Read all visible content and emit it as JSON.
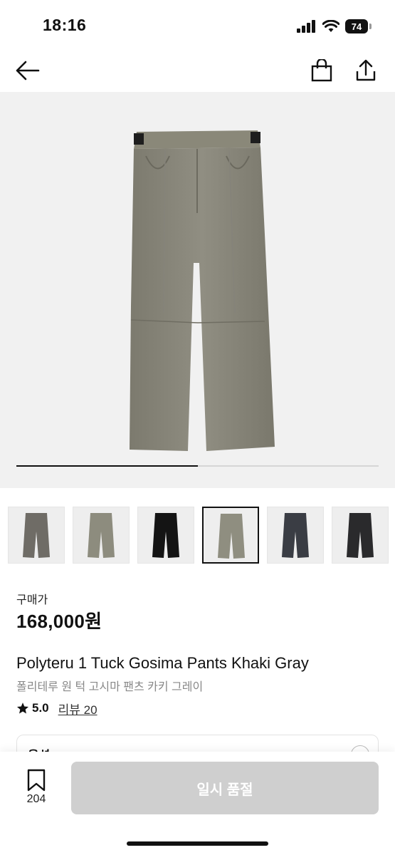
{
  "status_bar": {
    "time": "18:16",
    "battery": "74"
  },
  "nav": {
    "back_icon": "arrow-left-icon",
    "bag_icon": "shopping-bag-icon",
    "share_icon": "share-icon"
  },
  "gallery": {
    "progress": 0.5,
    "thumbnails": [
      {
        "color": "#6f6c66"
      },
      {
        "color": "#8d8c7e"
      },
      {
        "color": "#141414"
      },
      {
        "color": "#8f8e80",
        "active": true
      },
      {
        "color": "#3a3d44"
      },
      {
        "color": "#2a2a2c"
      }
    ]
  },
  "product": {
    "price_label": "구매가",
    "price": "168,000원",
    "title_en": "Polyteru 1 Tuck Gosima Pants Khaki Gray",
    "title_ko": "폴리테루 원 턱 고시마 팬츠 카키 그레이",
    "rating": "5.0",
    "review_link": "리뷰 20"
  },
  "option": {
    "label": "옵션"
  },
  "bottom": {
    "wish_count": "204",
    "soldout_label": "일시 품절"
  }
}
